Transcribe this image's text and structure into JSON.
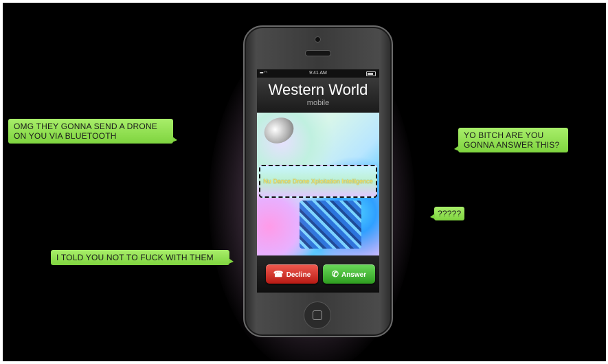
{
  "messages": {
    "top_left": "OMG THEY GONNA SEND A DRONE ON YOU VIA BLUETOOTH",
    "bottom_left": "I TOLD YOU NOT TO FUCK WITH   THEM",
    "top_right": "YO BITCH ARE YOU GONNA ANSWER THIS?",
    "mid_right": "?????"
  },
  "phone": {
    "status_time": "9:41 AM",
    "caller_name": "Western World",
    "caller_sub": "mobile",
    "banner_text": "Nu Dance Drone Xploitation Intelligence",
    "decline_label": "Decline",
    "answer_label": "Answer"
  },
  "colors": {
    "bubble": "#8fdf4f",
    "decline": "#d9342a",
    "answer": "#48bf37",
    "glow": "#f0c8f0"
  },
  "icons": [
    "phone-hangup-icon",
    "phone-answer-icon",
    "home-square-icon",
    "wifi-icon",
    "battery-icon"
  ]
}
